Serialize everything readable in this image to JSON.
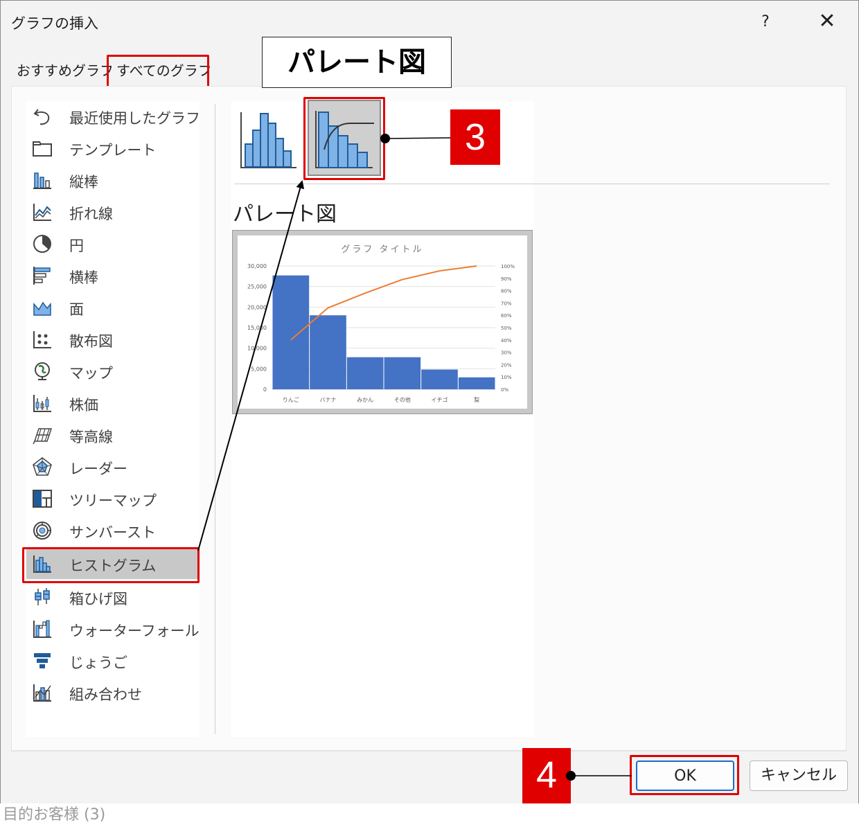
{
  "dialog": {
    "title": "グラフの挿入",
    "help_label": "?",
    "close_label": "✕"
  },
  "tabs": [
    {
      "label": "おすすめグラフ",
      "selected": false
    },
    {
      "label": "すべてのグラフ",
      "selected": true
    }
  ],
  "sidebar": {
    "items": [
      {
        "label": "最近使用したグラフ",
        "icon": "undo-icon"
      },
      {
        "label": "テンプレート",
        "icon": "folder-icon"
      },
      {
        "label": "縦棒",
        "icon": "column-chart-icon"
      },
      {
        "label": "折れ線",
        "icon": "line-chart-icon"
      },
      {
        "label": "円",
        "icon": "pie-chart-icon"
      },
      {
        "label": "横棒",
        "icon": "bar-chart-icon"
      },
      {
        "label": "面",
        "icon": "area-chart-icon"
      },
      {
        "label": "散布図",
        "icon": "scatter-chart-icon"
      },
      {
        "label": "マップ",
        "icon": "map-chart-icon"
      },
      {
        "label": "株価",
        "icon": "stock-chart-icon"
      },
      {
        "label": "等高線",
        "icon": "surface-chart-icon"
      },
      {
        "label": "レーダー",
        "icon": "radar-chart-icon"
      },
      {
        "label": "ツリーマップ",
        "icon": "treemap-chart-icon"
      },
      {
        "label": "サンバースト",
        "icon": "sunburst-chart-icon"
      },
      {
        "label": "ヒストグラム",
        "icon": "histogram-chart-icon",
        "selected": true
      },
      {
        "label": "箱ひげ図",
        "icon": "box-whisker-chart-icon"
      },
      {
        "label": "ウォーターフォール",
        "icon": "waterfall-chart-icon"
      },
      {
        "label": "じょうご",
        "icon": "funnel-chart-icon"
      },
      {
        "label": "組み合わせ",
        "icon": "combo-chart-icon"
      }
    ]
  },
  "subtype": {
    "title": "パレート図",
    "options": [
      "histogram",
      "pareto"
    ],
    "selected": "pareto"
  },
  "preview_chart": {
    "chart_data": {
      "type": "bar",
      "title": "グラフ タイトル",
      "categories": [
        "りんご",
        "バナナ",
        "みかん",
        "その他",
        "イチゴ",
        "梨"
      ],
      "values": [
        27700,
        18000,
        7800,
        7800,
        4800,
        2900
      ],
      "y_ticks": [
        "30,000",
        "25,000",
        "20,000",
        "15,000",
        "10,000",
        "5,000",
        "0"
      ],
      "ylim": [
        0,
        30000
      ],
      "y2_ticks": [
        "100%",
        "90%",
        "80%",
        "70%",
        "60%",
        "50%",
        "40%",
        "30%",
        "20%",
        "10%",
        "0%"
      ],
      "cumulative_percent": [
        40,
        66,
        78,
        89,
        96,
        100
      ],
      "bar_color": "#4472c4",
      "line_color": "#ed7d31"
    }
  },
  "buttons": {
    "ok": "OK",
    "cancel": "キャンセル"
  },
  "annotations": {
    "title_callout": "パレート図",
    "step3": "3",
    "step4": "4",
    "highlight_color": "#e00000"
  },
  "background_text": "目的お客様 (3)"
}
